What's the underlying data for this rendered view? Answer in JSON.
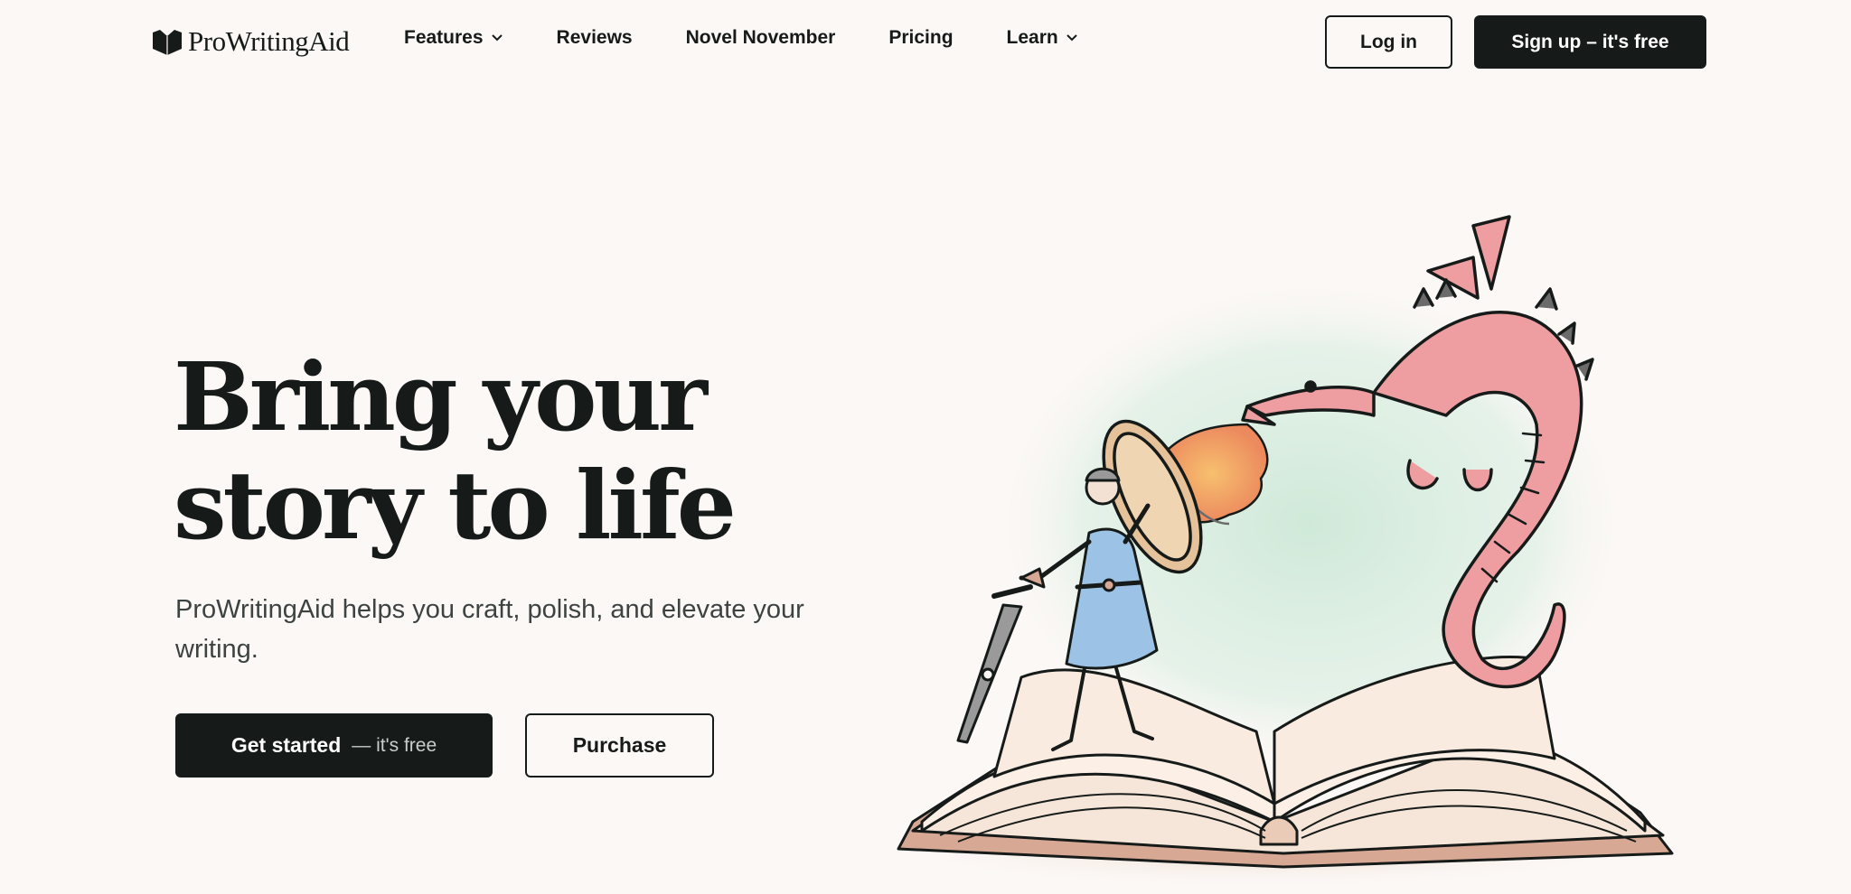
{
  "brand": {
    "name": "ProWritingAid",
    "logo_icon": "book-heart-icon"
  },
  "nav": {
    "items": [
      {
        "label": "Features",
        "has_dropdown": true
      },
      {
        "label": "Reviews",
        "has_dropdown": false
      },
      {
        "label": "Novel November",
        "has_dropdown": false
      },
      {
        "label": "Pricing",
        "has_dropdown": false
      },
      {
        "label": "Learn",
        "has_dropdown": true
      }
    ],
    "login_label": "Log in",
    "signup_label": "Sign up – it's free"
  },
  "hero": {
    "title_line1": "Bring your",
    "title_line2": "story to life",
    "subtitle": "ProWritingAid helps you craft, polish, and elevate your writing.",
    "cta_primary_main": "Get started",
    "cta_primary_aside": "— it's free",
    "cta_secondary": "Purchase"
  },
  "illustration": {
    "subject": "knight with pen-sword and shield facing a fire-breathing dragon rising from an open book"
  },
  "colors": {
    "background": "#fcf8f6",
    "ink": "#161b19",
    "dragon_pink": "#ee9ea0",
    "tunic_blue": "#9cc3e6",
    "glow_green": "#cfe9d9",
    "fire_orange": "#f3a266"
  }
}
